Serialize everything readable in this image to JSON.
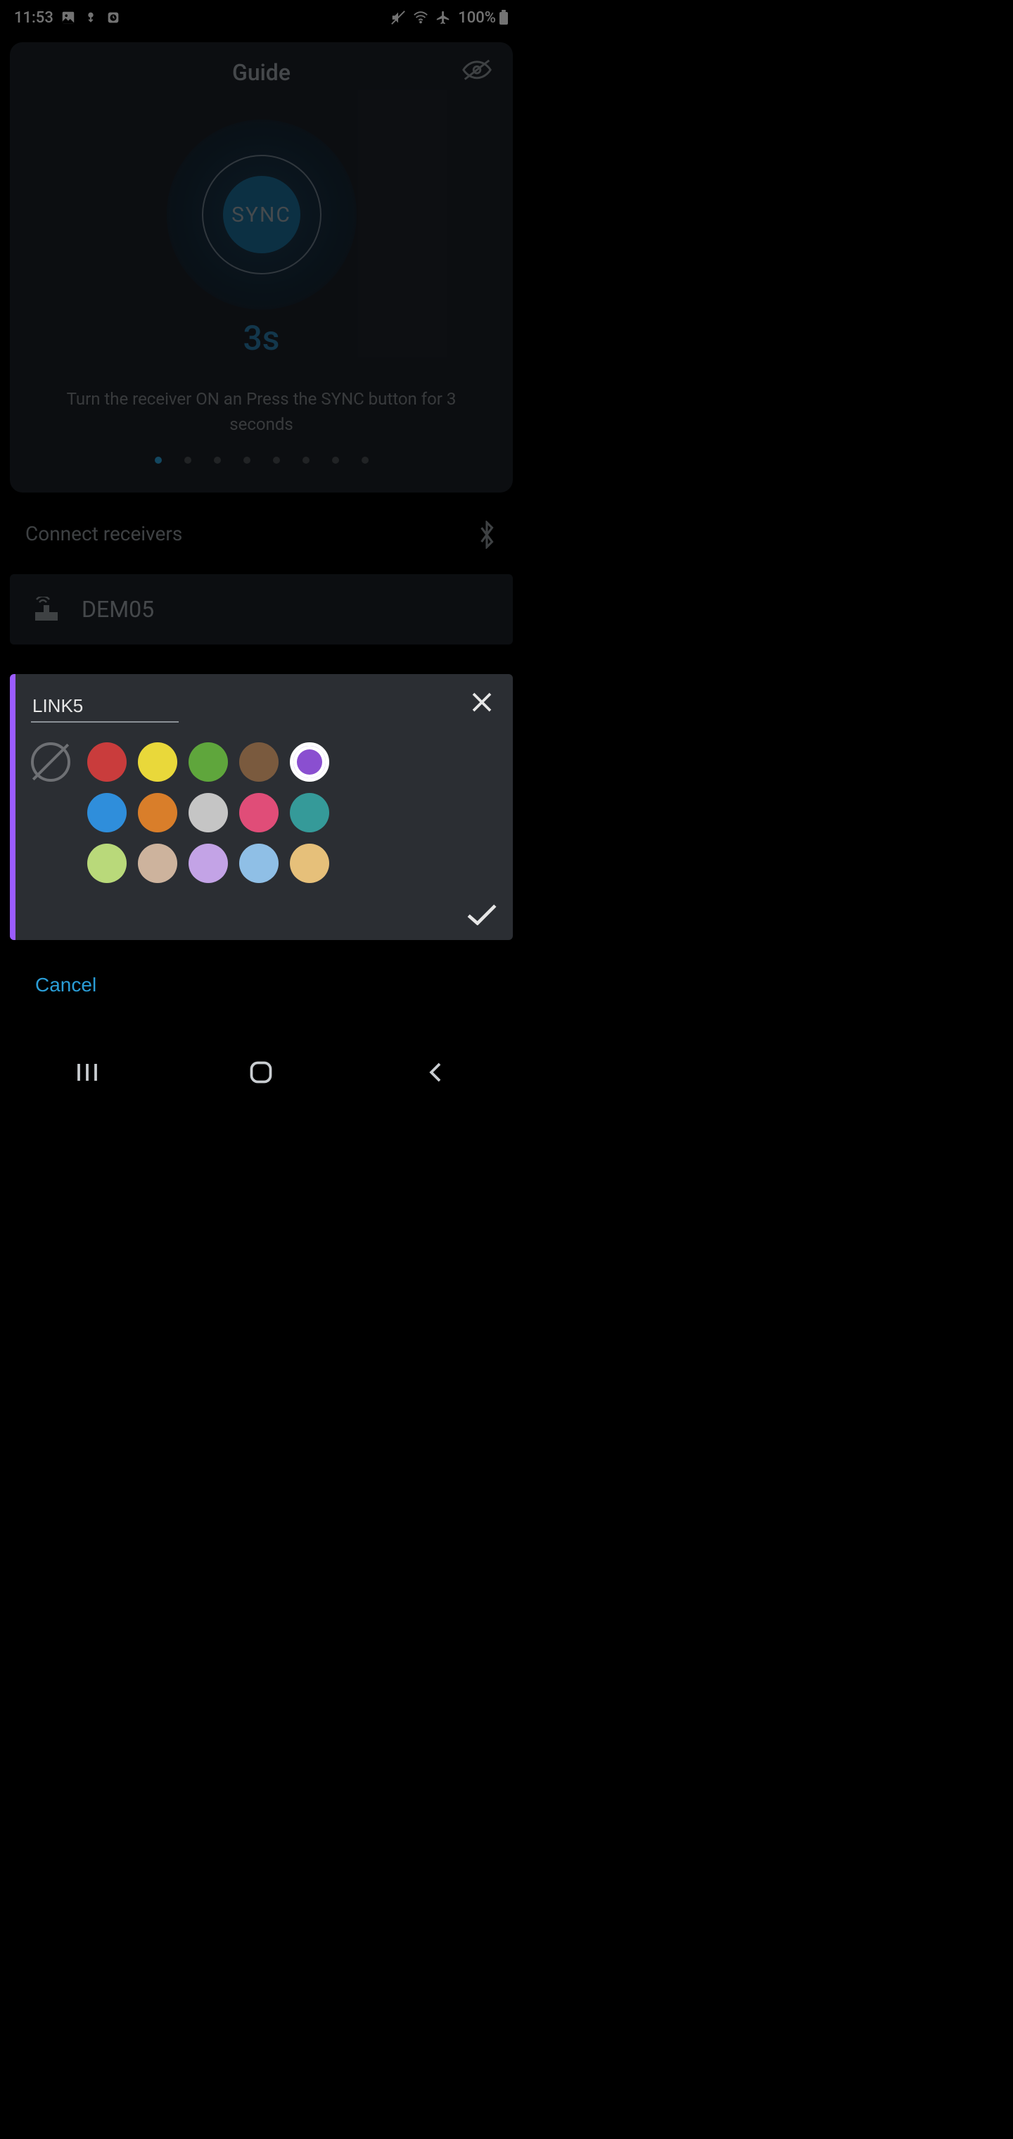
{
  "statusbar": {
    "time": "11:53",
    "battery": "100%"
  },
  "guide": {
    "title": "Guide",
    "sync_label": "SYNC",
    "timer": "3s",
    "instruction": "Turn the receiver ON an Press the SYNC button for 3 seconds",
    "page_count": 8,
    "active_page": 0
  },
  "section": {
    "label": "Connect receivers"
  },
  "device": {
    "name": "DEM05"
  },
  "modal": {
    "input_value": "LINK5",
    "colors": [
      {
        "hex": "#c93c3c",
        "selected": false
      },
      {
        "hex": "#e9d83a",
        "selected": false
      },
      {
        "hex": "#5fa63c",
        "selected": false
      },
      {
        "hex": "#7a5a3e",
        "selected": false
      },
      {
        "hex": "#8a4fd0",
        "selected": true
      },
      {
        "hex": "#2f8edb",
        "selected": false
      },
      {
        "hex": "#d97e2a",
        "selected": false
      },
      {
        "hex": "#c5c5c5",
        "selected": false
      },
      {
        "hex": "#e04d78",
        "selected": false
      },
      {
        "hex": "#359a99",
        "selected": false
      },
      {
        "hex": "#b9d97a",
        "selected": false
      },
      {
        "hex": "#cdb39d",
        "selected": false
      },
      {
        "hex": "#c3a3e6",
        "selected": false
      },
      {
        "hex": "#8fbfe6",
        "selected": false
      },
      {
        "hex": "#e6c07a",
        "selected": false
      }
    ]
  },
  "footer": {
    "cancel": "Cancel"
  }
}
